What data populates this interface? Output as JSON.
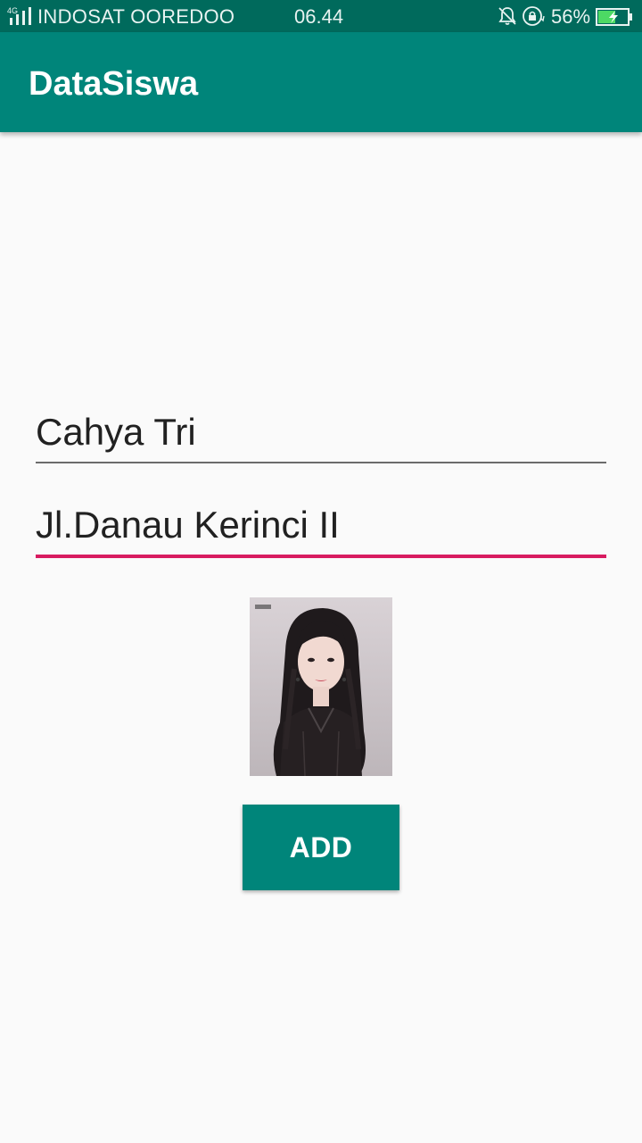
{
  "status_bar": {
    "network": "4G",
    "carrier": "INDOSAT OOREDOO",
    "time": "06.44",
    "battery_percent": "56%",
    "icons": [
      "signal-icon",
      "bell-muted-icon",
      "rotation-lock-icon",
      "battery-charging-icon"
    ]
  },
  "app_bar": {
    "title": "DataSiswa",
    "color": "#00857a"
  },
  "form": {
    "name_value": "Cahya Tri",
    "address_value": "Jl.Danau Kerinci II",
    "address_underline_color": "#d81b60",
    "photo_icon": "student-photo",
    "add_label": "ADD"
  }
}
